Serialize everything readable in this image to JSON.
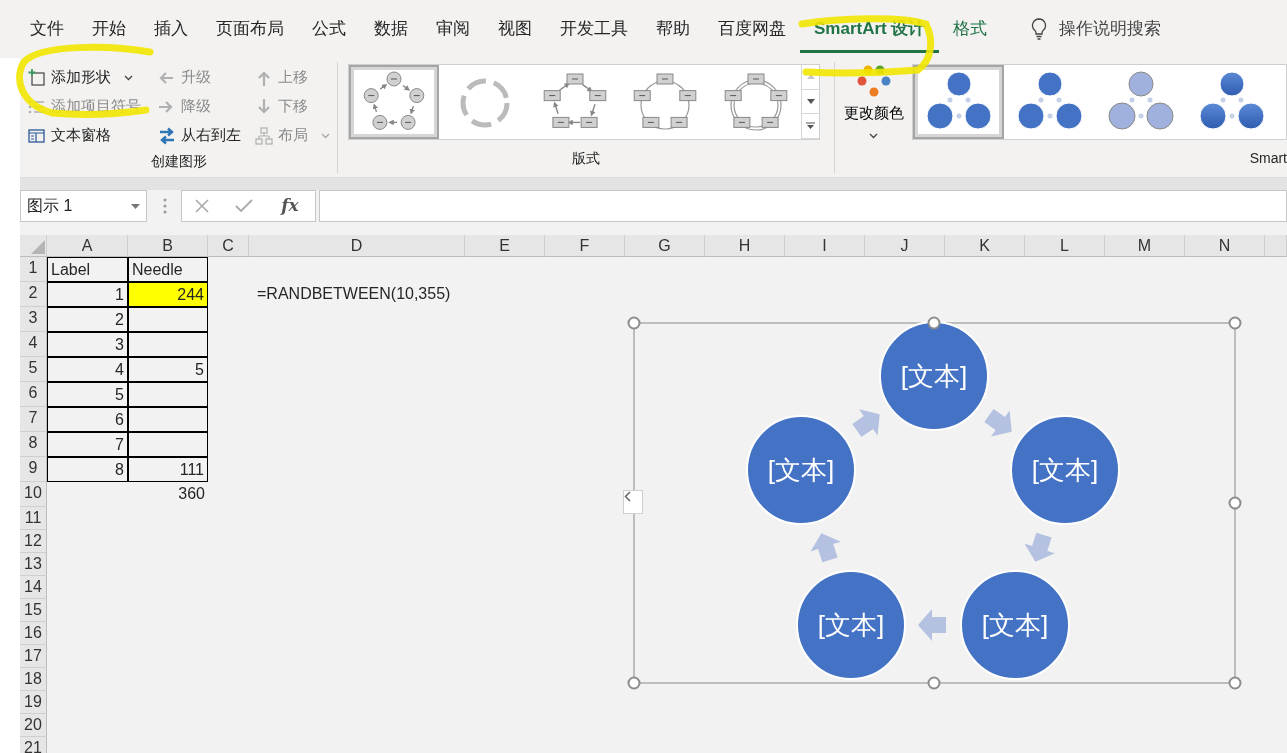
{
  "ribbon_tabs": [
    {
      "label": "文件",
      "kind": "standard",
      "selected": false
    },
    {
      "label": "开始",
      "kind": "standard",
      "selected": false
    },
    {
      "label": "插入",
      "kind": "standard",
      "selected": false
    },
    {
      "label": "页面布局",
      "kind": "standard",
      "selected": false
    },
    {
      "label": "公式",
      "kind": "standard",
      "selected": false
    },
    {
      "label": "数据",
      "kind": "standard",
      "selected": false
    },
    {
      "label": "审阅",
      "kind": "standard",
      "selected": false
    },
    {
      "label": "视图",
      "kind": "standard",
      "selected": false
    },
    {
      "label": "开发工具",
      "kind": "standard",
      "selected": false
    },
    {
      "label": "帮助",
      "kind": "standard",
      "selected": false
    },
    {
      "label": "百度网盘",
      "kind": "standard",
      "selected": false
    },
    {
      "label": "SmartArt 设计",
      "kind": "contextual",
      "selected": true
    },
    {
      "label": "格式",
      "kind": "contextual",
      "selected": false
    }
  ],
  "tell_me": {
    "label": "操作说明搜索"
  },
  "create_graphic_group": {
    "title": "创建图形",
    "buttons": [
      {
        "label": "添加形状",
        "disabled": false,
        "dropdown": true
      },
      {
        "label": "添加项目符号",
        "disabled": true,
        "dropdown": false
      },
      {
        "label": "文本窗格",
        "disabled": false,
        "dropdown": false
      },
      {
        "label": "升级",
        "disabled": true,
        "dropdown": false
      },
      {
        "label": "降级",
        "disabled": true,
        "dropdown": false
      },
      {
        "label": "从右到左",
        "disabled": false,
        "dropdown": false
      },
      {
        "label": "上移",
        "disabled": true,
        "dropdown": false
      },
      {
        "label": "下移",
        "disabled": true,
        "dropdown": false
      },
      {
        "label": "布局",
        "disabled": true,
        "dropdown": true
      }
    ]
  },
  "layouts_group": {
    "title": "版式",
    "thumbnails": [
      {
        "selected": true
      },
      {
        "selected": false
      },
      {
        "selected": false
      },
      {
        "selected": false
      },
      {
        "selected": false
      }
    ]
  },
  "smartart_styles_group": {
    "title": "Smart",
    "change_colors_label": "更改颜色",
    "styles": [
      {
        "selected": true
      },
      {
        "selected": false
      },
      {
        "selected": false
      },
      {
        "selected": false
      }
    ]
  },
  "formula_bar": {
    "name_box": "图示 1",
    "function_label": "fx"
  },
  "sheet": {
    "columns": [
      "A",
      "B",
      "C",
      "D",
      "E",
      "F",
      "G",
      "H",
      "I",
      "J",
      "K",
      "L",
      "M",
      "N"
    ],
    "rows": [
      {
        "header": "1",
        "boxed": true,
        "col_a": {
          "text": "Label",
          "numeric": false,
          "highlighted": false
        },
        "col_b": {
          "text": "Needle",
          "numeric": false,
          "highlighted": false
        }
      },
      {
        "header": "2",
        "boxed": true,
        "col_a": {
          "text": "1",
          "numeric": true,
          "highlighted": false
        },
        "col_b": {
          "text": "244",
          "numeric": true,
          "highlighted": true
        },
        "col_d": {
          "text": "=RANDBETWEEN(10,355)",
          "numeric": false,
          "highlighted": false
        }
      },
      {
        "header": "3",
        "boxed": true,
        "col_a": {
          "text": "2",
          "numeric": true,
          "highlighted": false
        }
      },
      {
        "header": "4",
        "boxed": true,
        "col_a": {
          "text": "3",
          "numeric": true,
          "highlighted": false
        }
      },
      {
        "header": "5",
        "boxed": true,
        "col_a": {
          "text": "4",
          "numeric": true,
          "highlighted": false
        },
        "col_b": {
          "text": "5",
          "numeric": true,
          "highlighted": false
        }
      },
      {
        "header": "6",
        "boxed": true,
        "col_a": {
          "text": "5",
          "numeric": true,
          "highlighted": false
        }
      },
      {
        "header": "7",
        "boxed": true,
        "col_a": {
          "text": "6",
          "numeric": true,
          "highlighted": false
        }
      },
      {
        "header": "8",
        "boxed": true,
        "col_a": {
          "text": "7",
          "numeric": true,
          "highlighted": false
        }
      },
      {
        "header": "9",
        "boxed": true,
        "col_a": {
          "text": "8",
          "numeric": true,
          "highlighted": false
        },
        "col_b": {
          "text": "111",
          "numeric": true,
          "highlighted": false
        }
      },
      {
        "header": "10",
        "boxed": false,
        "col_b": {
          "text": "360",
          "numeric": true,
          "highlighted": false
        }
      },
      {
        "header": "11",
        "boxed": false
      },
      {
        "header": "12",
        "boxed": false
      },
      {
        "header": "13",
        "boxed": false
      },
      {
        "header": "14",
        "boxed": false
      },
      {
        "header": "15",
        "boxed": false
      },
      {
        "header": "16",
        "boxed": false
      },
      {
        "header": "17",
        "boxed": false
      },
      {
        "header": "18",
        "boxed": false
      },
      {
        "header": "19",
        "boxed": false
      },
      {
        "header": "20",
        "boxed": false
      },
      {
        "header": "21",
        "boxed": false
      }
    ]
  },
  "smartart": {
    "nodes": [
      {
        "text": "[文本]"
      },
      {
        "text": "[文本]"
      },
      {
        "text": "[文本]"
      },
      {
        "text": "[文本]"
      },
      {
        "text": "[文本]"
      }
    ]
  }
}
